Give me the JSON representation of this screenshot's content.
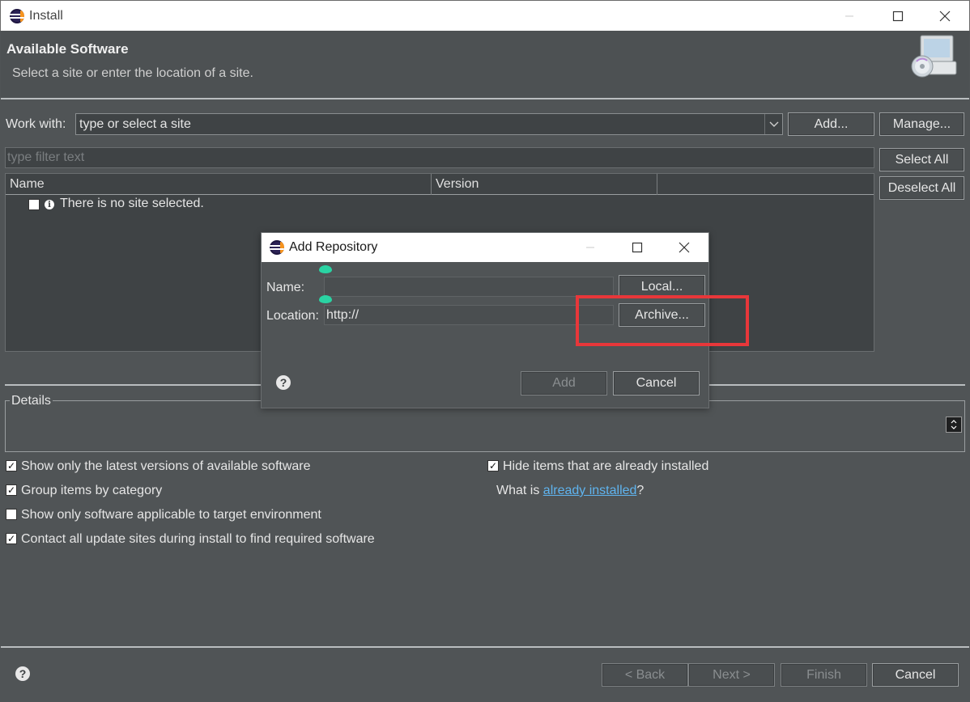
{
  "window": {
    "title": "Install"
  },
  "header": {
    "title": "Available Software",
    "subtitle": "Select a site or enter the location of a site."
  },
  "work_with": {
    "label": "Work with:",
    "placeholder": "type or select a site",
    "add_label": "Add...",
    "manage_label": "Manage..."
  },
  "filter": {
    "placeholder": "type filter text"
  },
  "buttons": {
    "select_all": "Select All",
    "deselect_all": "Deselect All"
  },
  "table": {
    "columns": [
      "Name",
      "Version"
    ],
    "message": "There is no site selected."
  },
  "details": {
    "legend": "Details"
  },
  "options": {
    "latest_versions": "Show only the latest versions of available software",
    "group_by_category": "Group items by category",
    "applicable_only": "Show only software applicable to target environment",
    "contact_all": "Contact all update sites during install to find required software",
    "hide_installed": "Hide items that are already installed",
    "what_is_prefix": "What is ",
    "what_is_link": "already installed",
    "what_is_suffix": "?"
  },
  "footer": {
    "back": "< Back",
    "next": "Next >",
    "finish": "Finish",
    "cancel": "Cancel"
  },
  "dialog": {
    "title": "Add Repository",
    "name_label": "Name:",
    "name_value": "",
    "location_label": "Location:",
    "location_value": "http://",
    "local_button": "Local...",
    "archive_button": "Archive...",
    "add_button": "Add",
    "cancel_button": "Cancel"
  },
  "colors": {
    "background": "#505456",
    "highlight": "#e8373a",
    "link": "#5fb4ef"
  }
}
